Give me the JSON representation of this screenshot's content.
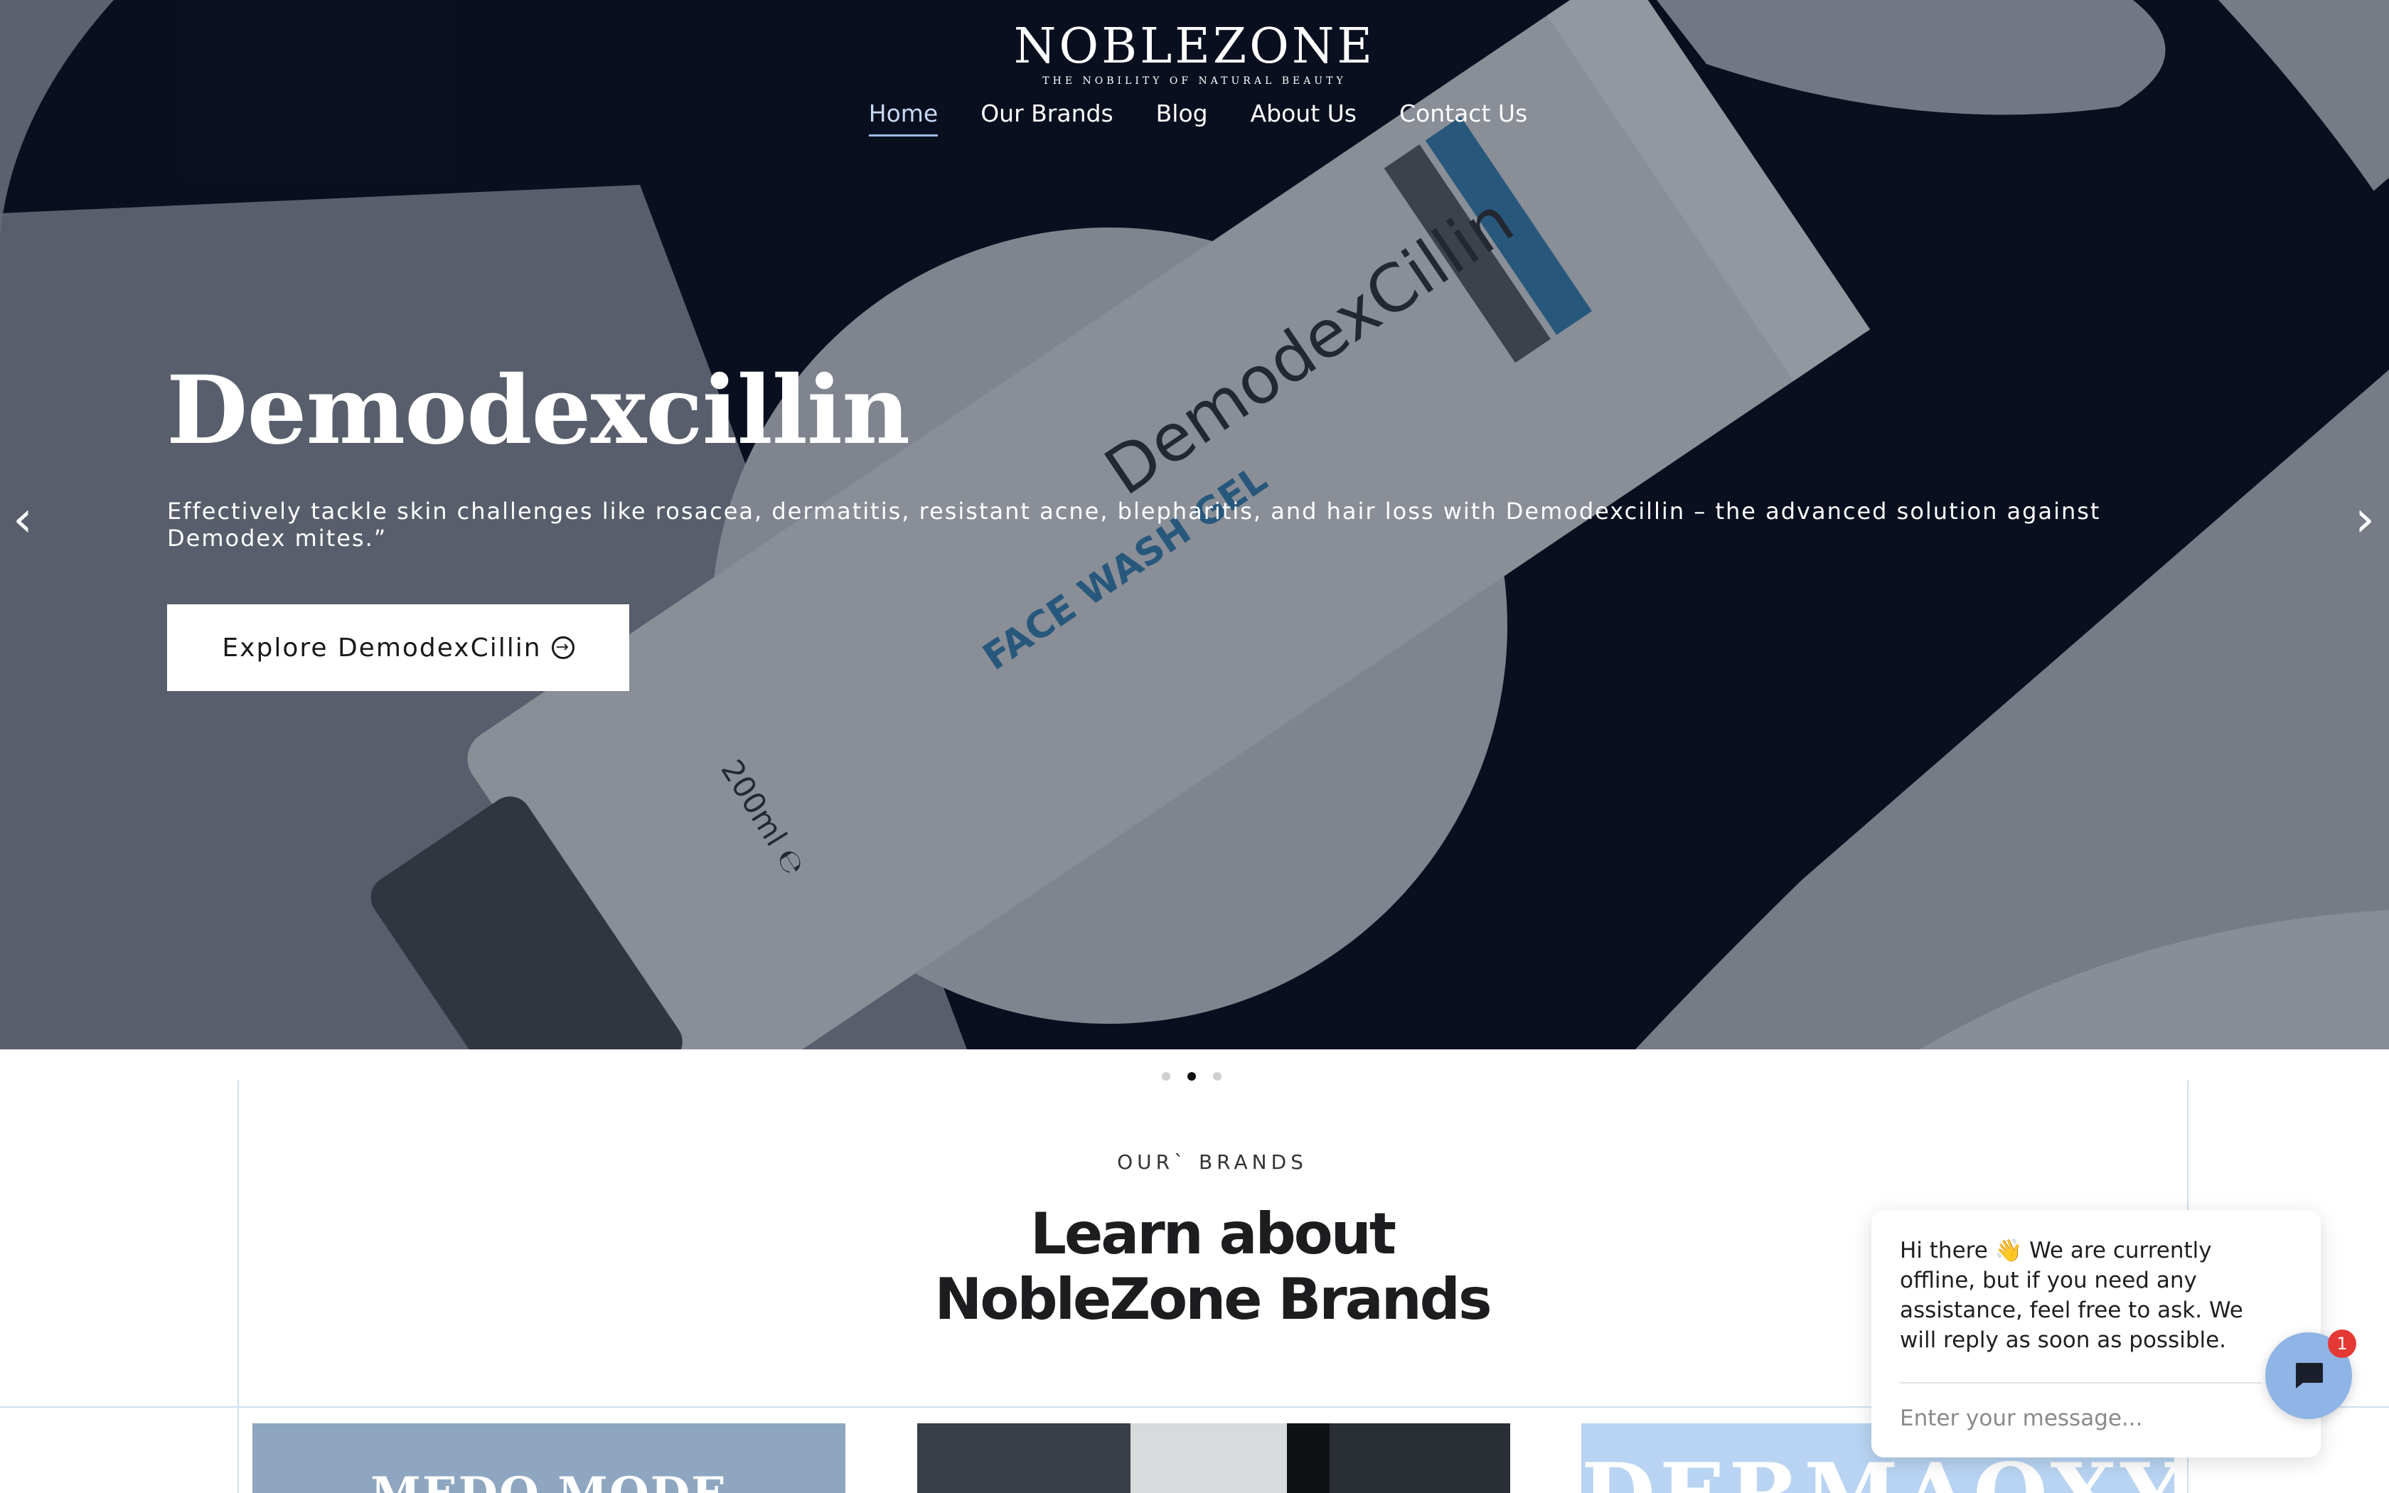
{
  "header": {
    "logo_word": "NOBLEZONE",
    "logo_tagline": "THE NOBILITY OF NATURAL BEAUTY",
    "nav": [
      {
        "label": "Home",
        "active": true
      },
      {
        "label": "Our Brands",
        "active": false
      },
      {
        "label": "Blog",
        "active": false
      },
      {
        "label": "About Us",
        "active": false
      },
      {
        "label": "Contact Us",
        "active": false
      }
    ]
  },
  "hero": {
    "title": "Demodexcillin",
    "description": "Effectively tackle skin challenges like rosacea, dermatitis, resistant acne, blepharitis, and hair loss with Demodexcillin – the advanced solution against Demodex mites.”",
    "button_label": "Explore DemodexCillin",
    "button_icon": "circle-arrow-right-icon",
    "prev_icon": "chevron-left-icon",
    "next_icon": "chevron-right-icon",
    "product": {
      "brand": "DemodexCillin",
      "type": "FACE WASH GEL",
      "volume": "200ml ℮"
    },
    "slides": {
      "count": 3,
      "active_index": 1
    }
  },
  "brands": {
    "kicker": "OUR` BRANDS",
    "title_line1": "Learn about",
    "title_line2": "NobleZone Brands",
    "cards": [
      {
        "text": "MEDO MODE",
        "color": "#8ea6c0"
      },
      {
        "text": "",
        "color": "#2a2e35"
      },
      {
        "text": "DERMAOXY",
        "color": "#b8d4f2"
      }
    ]
  },
  "chat": {
    "message": "Hi there 👋 We are currently offline, but if you need any assistance, feel free to ask. We will reply as soon as possible.",
    "placeholder": "Enter your message...",
    "badge_count": "1",
    "icon": "chat-bubble-icon"
  },
  "colors": {
    "hero_background": "#0b1120",
    "accent": "#8fb4e6",
    "badge": "#e53935"
  }
}
